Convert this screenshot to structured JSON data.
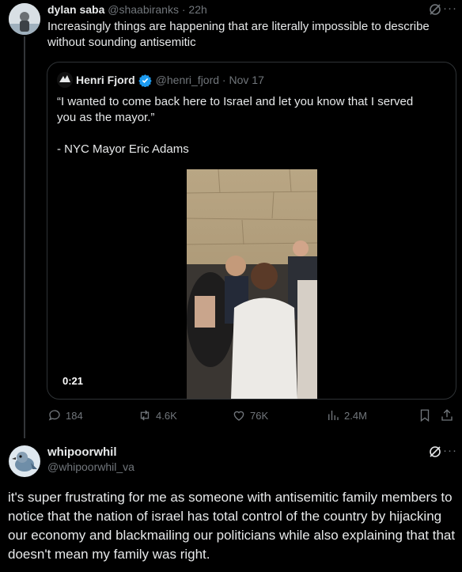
{
  "tweet": {
    "author_name": "dylan saba",
    "author_handle": "@shaabiranks",
    "time": "22h",
    "text": "Increasingly things are happening that are literally impossible to describe without sounding antisemitic",
    "icons": [
      "grok-icon",
      "more-icon"
    ]
  },
  "quote": {
    "author_name": "Henri Fjord",
    "author_handle": "@henri_fjord",
    "date": "Nov 17",
    "text": "“I wanted to come back here to Israel and let you know that I served you as the mayor.”\n\n- NYC Mayor Eric Adams",
    "video_time": "0:21"
  },
  "actions": {
    "replies": "184",
    "reposts": "4.6K",
    "likes": "76K",
    "views": "2.4M"
  },
  "reply": {
    "author_name": "whipoorwhil",
    "author_handle": "@whipoorwhil_va",
    "text": "it's super frustrating for me as someone with antisemitic family members to notice that the nation of israel has total control of the country by hijacking our economy and blackmailing our politicians while also explaining that that doesn't mean my family was right."
  },
  "colors": {
    "background": "#000000",
    "text": "#e7e9ea",
    "muted": "#71767b",
    "border": "#2f3336",
    "verified": "#1d9bf0"
  }
}
